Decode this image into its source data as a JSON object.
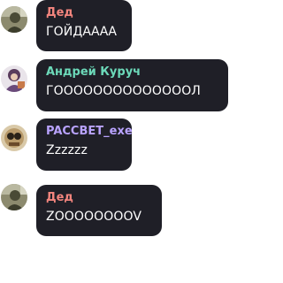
{
  "colors": {
    "bubble_bg": "#1f1f27",
    "message_text": "#ffffff"
  },
  "messages": [
    {
      "sender": "Дед",
      "sender_color": "#f3857e",
      "text": "ГОЙДАААА",
      "avatar_icon": "user-avatar-photo"
    },
    {
      "sender": "Андрей Куруч",
      "sender_color": "#6cd9b9",
      "text": "ГООООООООООООООЛ",
      "avatar_icon": "user-avatar-photo"
    },
    {
      "sender": "PACCBET_exe",
      "sender_color": "#b9a3ff",
      "text": "Zzzzzz",
      "avatar_icon": "user-avatar-photo"
    },
    {
      "sender": "Дед",
      "sender_color": "#f3857e",
      "text": "ZOOOOOOOOV",
      "avatar_icon": "user-avatar-photo"
    }
  ]
}
